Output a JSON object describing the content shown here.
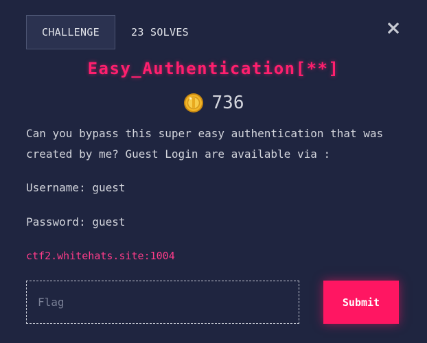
{
  "tabs": {
    "challenge_label": "CHALLENGE",
    "solves_label": "23 SOLVES"
  },
  "close": {
    "icon": "close-icon"
  },
  "challenge": {
    "title": "Easy_Authentication[**]",
    "points": "736",
    "points_icon": "coin-icon",
    "description_line1": "Can you bypass this super easy authentication that was",
    "description_line2": "created by me? Guest Login are available via :",
    "username_line": "Username: guest",
    "password_line": "Password: guest",
    "link_text": "ctf2.whitehats.site:1004"
  },
  "form": {
    "flag_placeholder": "Flag",
    "flag_value": "",
    "submit_label": "Submit"
  },
  "colors": {
    "background": "#1f2540",
    "accent": "#ff1f6e",
    "link": "#ff3c8a",
    "coin": "#f2b527"
  }
}
